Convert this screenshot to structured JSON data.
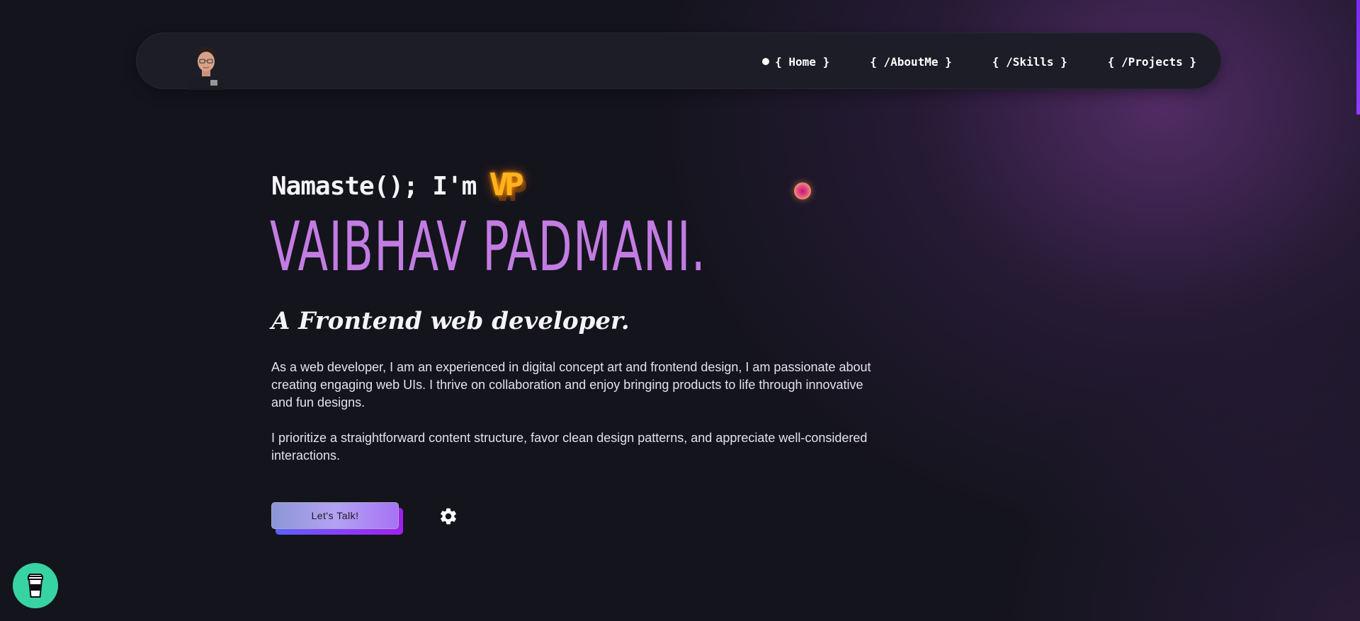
{
  "nav": {
    "items": [
      {
        "label": "{ Home }",
        "active": true
      },
      {
        "label": "{ /AboutMe }",
        "active": false
      },
      {
        "label": "{ /Skills }",
        "active": false
      },
      {
        "label": "{ /Projects }",
        "active": false
      }
    ]
  },
  "hero": {
    "greeting": "Namaste(); I'm",
    "initials": "VP",
    "name": "Vaibhav Padmani.",
    "role": "A Frontend web developer.",
    "paragraph_1": "As a web developer, I am an experienced in digital concept art and frontend design, I am passionate about creating engaging web UIs. I thrive on collaboration and enjoy bringing products to life through innovative and fun designs.",
    "paragraph_2": "I prioritize a straightforward content structure, favor clean design patterns, and appreciate well-considered interactions.",
    "cta_label": "Let's Talk!"
  },
  "icons": {
    "settings": "gear-icon",
    "coffee": "coffee-cup-icon",
    "avatar": "avatar"
  },
  "colors": {
    "background": "#14141d",
    "name": "#c27ce2",
    "neon": "#ffb21d",
    "coffee": "#37d3a3",
    "accent": "#8f3cff"
  }
}
